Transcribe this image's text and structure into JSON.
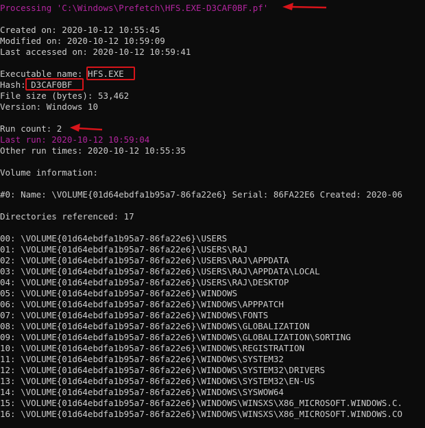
{
  "processing": "Processing 'C:\\Windows\\Prefetch\\HFS.EXE-D3CAF0BF.pf'",
  "created": "Created on: 2020-10-12 10:55:45",
  "modified": "Modified on: 2020-10-12 10:59:09",
  "accessed": "Last accessed on: 2020-10-12 10:59:41",
  "exe_label": "Executable name: ",
  "exe_value": "HFS.EXE",
  "hash_label": "Hash: ",
  "hash_value": "D3CAF0BF",
  "file_size": "File size (bytes): 53,462",
  "version": "Version: Windows 10",
  "run_count": "Run count: 2",
  "last_run": "Last run: 2020-10-12 10:59:04",
  "other_runs": "Other run times: 2020-10-12 10:55:35",
  "volume_header": "Volume information:",
  "volume_line": "#0: Name: \\VOLUME{01d64ebdfa1b95a7-86fa22e6} Serial: 86FA22E6 Created: 2020-06",
  "dirs_header": "Directories referenced: 17",
  "directories": [
    "00: \\VOLUME{01d64ebdfa1b95a7-86fa22e6}\\USERS",
    "01: \\VOLUME{01d64ebdfa1b95a7-86fa22e6}\\USERS\\RAJ",
    "02: \\VOLUME{01d64ebdfa1b95a7-86fa22e6}\\USERS\\RAJ\\APPDATA",
    "03: \\VOLUME{01d64ebdfa1b95a7-86fa22e6}\\USERS\\RAJ\\APPDATA\\LOCAL",
    "04: \\VOLUME{01d64ebdfa1b95a7-86fa22e6}\\USERS\\RAJ\\DESKTOP",
    "05: \\VOLUME{01d64ebdfa1b95a7-86fa22e6}\\WINDOWS",
    "06: \\VOLUME{01d64ebdfa1b95a7-86fa22e6}\\WINDOWS\\APPPATCH",
    "07: \\VOLUME{01d64ebdfa1b95a7-86fa22e6}\\WINDOWS\\FONTS",
    "08: \\VOLUME{01d64ebdfa1b95a7-86fa22e6}\\WINDOWS\\GLOBALIZATION",
    "09: \\VOLUME{01d64ebdfa1b95a7-86fa22e6}\\WINDOWS\\GLOBALIZATION\\SORTING",
    "10: \\VOLUME{01d64ebdfa1b95a7-86fa22e6}\\WINDOWS\\REGISTRATION",
    "11: \\VOLUME{01d64ebdfa1b95a7-86fa22e6}\\WINDOWS\\SYSTEM32",
    "12: \\VOLUME{01d64ebdfa1b95a7-86fa22e6}\\WINDOWS\\SYSTEM32\\DRIVERS",
    "13: \\VOLUME{01d64ebdfa1b95a7-86fa22e6}\\WINDOWS\\SYSTEM32\\EN-US",
    "14: \\VOLUME{01d64ebdfa1b95a7-86fa22e6}\\WINDOWS\\SYSWOW64",
    "15: \\VOLUME{01d64ebdfa1b95a7-86fa22e6}\\WINDOWS\\WINSXS\\X86_MICROSOFT.WINDOWS.C.",
    "16: \\VOLUME{01d64ebdfa1b95a7-86fa22e6}\\WINDOWS\\WINSXS\\X86_MICROSOFT.WINDOWS.CO"
  ],
  "colors": {
    "background": "#0c0c0c",
    "text": "#cccccc",
    "highlight_text": "#b3259f",
    "annotation": "#d8141a"
  }
}
